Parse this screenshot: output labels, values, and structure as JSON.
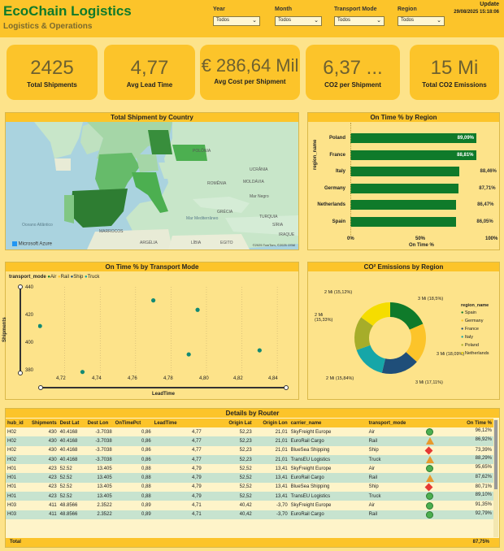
{
  "header": {
    "title": "EcoChain Logistics",
    "subtitle": "Logistics & Operations",
    "filters": [
      {
        "label": "Year",
        "value": "Todos"
      },
      {
        "label": "Month",
        "value": "Todos"
      },
      {
        "label": "Transport Mode",
        "value": "Todos"
      },
      {
        "label": "Region",
        "value": "Todos"
      }
    ],
    "update_label": "Update",
    "update_value": "29/08/2025 15:18:06"
  },
  "kpis": [
    {
      "value": "2425",
      "label": "Total Shipments"
    },
    {
      "value": "4,77",
      "label": "Avg Lead Time"
    },
    {
      "value": "€ 286,64 Mil",
      "label": "Avg Cost per Shipment"
    },
    {
      "value": "6,37 ...",
      "label": "CO2 per Shipment"
    },
    {
      "value": "15 Mi",
      "label": "Total CO2 Emissions"
    }
  ],
  "map": {
    "title": "Total Shipment by Country",
    "labels": [
      "POLÔNIA",
      "UCRÂNIA",
      "ROMÊNIA",
      "MOLDÁVIA",
      "Mar Negro",
      "TURQUIA",
      "SÍRIA",
      "IRAQUE",
      "GRÉCIA",
      "Mar Mediterrâneo",
      "MARROCOS",
      "ARGÉLIA",
      "LÍBIA",
      "EGITO",
      "Oceano Atlântico"
    ],
    "brand": "Microsoft Azure",
    "copyright": "©2025 TomTom, ©2025 OSM"
  },
  "region_chart": {
    "title": "On Time % by Region",
    "ylabel": "region_name",
    "xlabel": "On Time %",
    "ticks": [
      "0%",
      "50%",
      "100%"
    ]
  },
  "transport_chart": {
    "title": "On Time % by Transport Mode",
    "legend_title": "transport_mode",
    "legend": [
      "Air",
      "Rail",
      "Ship",
      "Truck"
    ],
    "ylabel": "Shipments",
    "xlabel": "LeadTime",
    "yticks": [
      "440",
      "420",
      "400",
      "380"
    ],
    "xticks": [
      "4,72",
      "4,74",
      "4,76",
      "4,78",
      "4,80",
      "4,82",
      "4,84"
    ]
  },
  "co2_chart": {
    "title": "CO² Emissions by Region",
    "legend_title": "region_name",
    "legend": [
      "Spain",
      "Germany",
      "France",
      "Italy",
      "Poland",
      "Netherlands"
    ],
    "labels": [
      "3 Mi (18,5%)",
      "3 Mi (18,09%)",
      "3 Mi (17,11%)",
      "2 Mi (15,84%)",
      "2 Mi (15,33%)",
      "2 Mi (15,12%)"
    ]
  },
  "table": {
    "title": "Details by Router",
    "columns": [
      "hub_id",
      "Shipments",
      "Dest Lat",
      "Dest Lon",
      "OnTimePct",
      "LeadTime",
      "Origin Lat",
      "Origin Lon",
      "carrier_name",
      "transport_mode",
      "On Time %"
    ],
    "rows": [
      [
        "H02",
        "430",
        "40.4168",
        "-3.7038",
        "0,86",
        "4,77",
        "52,23",
        "21,01",
        "SkyFreight Europe",
        "Air",
        "96,12%"
      ],
      [
        "H02",
        "430",
        "40.4168",
        "-3.7038",
        "0,86",
        "4,77",
        "52,23",
        "21,01",
        "EuroRail Cargo",
        "Rail",
        "86,92%"
      ],
      [
        "H02",
        "430",
        "40.4168",
        "-3.7038",
        "0,86",
        "4,77",
        "52,23",
        "21,01",
        "BlueSea Shipping",
        "Ship",
        "73,39%"
      ],
      [
        "H02",
        "430",
        "40.4168",
        "-3.7038",
        "0,86",
        "4,77",
        "52,23",
        "21,01",
        "TransEU Logistics",
        "Truck",
        "88,29%"
      ],
      [
        "H01",
        "423",
        "52.52",
        "13.405",
        "0,88",
        "4,79",
        "52,52",
        "13,41",
        "SkyFreight Europe",
        "Air",
        "95,65%"
      ],
      [
        "H01",
        "423",
        "52.52",
        "13.405",
        "0,88",
        "4,79",
        "52,52",
        "13,41",
        "EuroRail Cargo",
        "Rail",
        "87,62%"
      ],
      [
        "H01",
        "423",
        "52.52",
        "13.405",
        "0,88",
        "4,79",
        "52,52",
        "13,41",
        "BlueSea Shipping",
        "Ship",
        "80,71%"
      ],
      [
        "H01",
        "423",
        "52.52",
        "13.405",
        "0,88",
        "4,79",
        "52,52",
        "13,41",
        "TransEU Logistics",
        "Truck",
        "89,10%"
      ],
      [
        "H03",
        "411",
        "48.8566",
        "2.3522",
        "0,89",
        "4,71",
        "40,42",
        "-3,70",
        "SkyFreight Europe",
        "Air",
        "91,35%"
      ],
      [
        "H03",
        "411",
        "48.8566",
        "2.3522",
        "0,89",
        "4,71",
        "40,42",
        "-3,70",
        "EuroRail Cargo",
        "Rail",
        "92,79%"
      ]
    ],
    "indicators": [
      "circle",
      "triangle",
      "diamond",
      "triangle",
      "circle",
      "triangle",
      "diamond",
      "circle",
      "circle",
      "circle"
    ],
    "total_label": "Total",
    "total_value": "87,75%"
  },
  "colors": {
    "green": "#0f7a2a",
    "yellow": "#fcc42a",
    "navy": "#1f4e79",
    "teal": "#16a6a8",
    "olive": "#a6ad2a",
    "bright_yellow": "#f5dd00"
  },
  "chart_data": [
    {
      "type": "bar",
      "title": "On Time % by Region",
      "categories": [
        "Poland",
        "France",
        "Italy",
        "Germany",
        "Netherlands",
        "Spain"
      ],
      "values": [
        89.09,
        88.81,
        88.46,
        87.71,
        86.47,
        86.05
      ],
      "labels": [
        "89,09%",
        "88,81%",
        "88,46%",
        "87,71%",
        "86,47%",
        "86,05%"
      ],
      "xlabel": "On Time %",
      "ylabel": "region_name",
      "xlim": [
        0,
        100
      ]
    },
    {
      "type": "scatter",
      "title": "On Time % by Transport Mode",
      "xlabel": "LeadTime",
      "ylabel": "Shipments",
      "xlim": [
        4.705,
        4.845
      ],
      "ylim": [
        375,
        440
      ],
      "points": [
        {
          "x": 4.706,
          "y": 411
        },
        {
          "x": 4.73,
          "y": 377
        },
        {
          "x": 4.77,
          "y": 430
        },
        {
          "x": 4.79,
          "y": 390
        },
        {
          "x": 4.795,
          "y": 423
        },
        {
          "x": 4.83,
          "y": 393
        }
      ]
    },
    {
      "type": "pie",
      "title": "CO² Emissions by Region",
      "categories": [
        "Spain",
        "Germany",
        "France",
        "Italy",
        "Poland",
        "Netherlands"
      ],
      "values": [
        18.5,
        18.09,
        17.11,
        15.84,
        15.33,
        15.12
      ]
    }
  ]
}
